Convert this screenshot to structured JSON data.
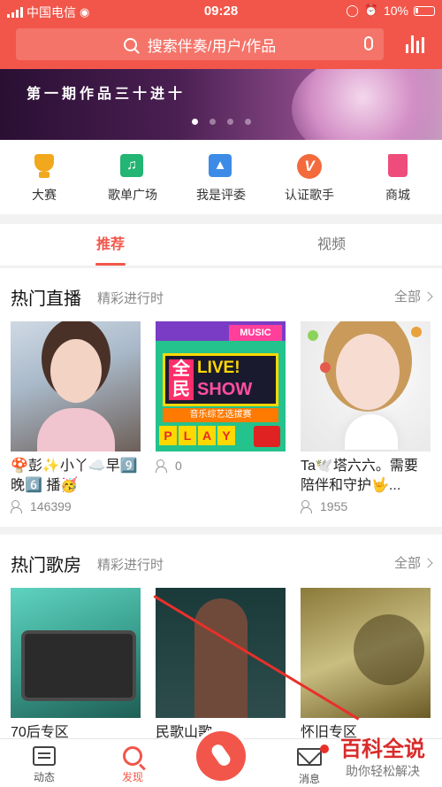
{
  "status_bar": {
    "carrier": "中国电信",
    "time": "09:28",
    "battery": "10%"
  },
  "search": {
    "placeholder": "搜索伴奏/用户/作品"
  },
  "banner": {
    "subtitle": "第一期作品三十进十",
    "active_dot": 0,
    "dot_count": 4
  },
  "quick_nav": [
    {
      "label": "大赛",
      "icon": "trophy-icon"
    },
    {
      "label": "歌单广场",
      "icon": "music-note-icon"
    },
    {
      "label": "我是评委",
      "icon": "thumbs-up-icon"
    },
    {
      "label": "认证歌手",
      "icon": "v-badge-icon"
    },
    {
      "label": "商城",
      "icon": "shopping-bag-icon"
    }
  ],
  "tabs": [
    {
      "label": "推荐",
      "active": true
    },
    {
      "label": "视频",
      "active": false
    }
  ],
  "hot_live": {
    "title": "热门直播",
    "subtitle": "精彩进行时",
    "more": "全部",
    "cards": [
      {
        "title": "🍄彭✨小丫☁️早9️⃣ 晚6️⃣ 播🥳",
        "viewers": "146399"
      },
      {
        "title": "",
        "viewers": "0",
        "poster": {
          "music": "MUSIC",
          "quan": "全民",
          "live": "LIVE!",
          "show": "SHOW",
          "band": "音乐综艺选拔赛",
          "play": [
            "P",
            "L",
            "A",
            "Y"
          ]
        }
      },
      {
        "title": "Ta🕊️塔六六。需要陪伴和守护🤟...",
        "viewers": "1955"
      }
    ]
  },
  "hot_rooms": {
    "title": "热门歌房",
    "subtitle": "精彩进行时",
    "more": "全部",
    "cards": [
      {
        "title": "70后专区"
      },
      {
        "title": "民歌山歌"
      },
      {
        "title": "怀旧专区"
      }
    ]
  },
  "tab_bar": [
    {
      "label": "动态",
      "icon": "feed-icon",
      "active": false
    },
    {
      "label": "发现",
      "icon": "search-icon",
      "active": true
    },
    {
      "label": "",
      "icon": "microphone-icon",
      "active": false
    },
    {
      "label": "消息",
      "icon": "mail-icon",
      "active": false,
      "badge": true
    },
    {
      "label": "",
      "icon": "",
      "active": false
    }
  ],
  "watermark": {
    "main": "百科全说",
    "sub": "助你轻松解决"
  },
  "colors": {
    "accent": "#f2564a",
    "badge": "#e8302a"
  }
}
